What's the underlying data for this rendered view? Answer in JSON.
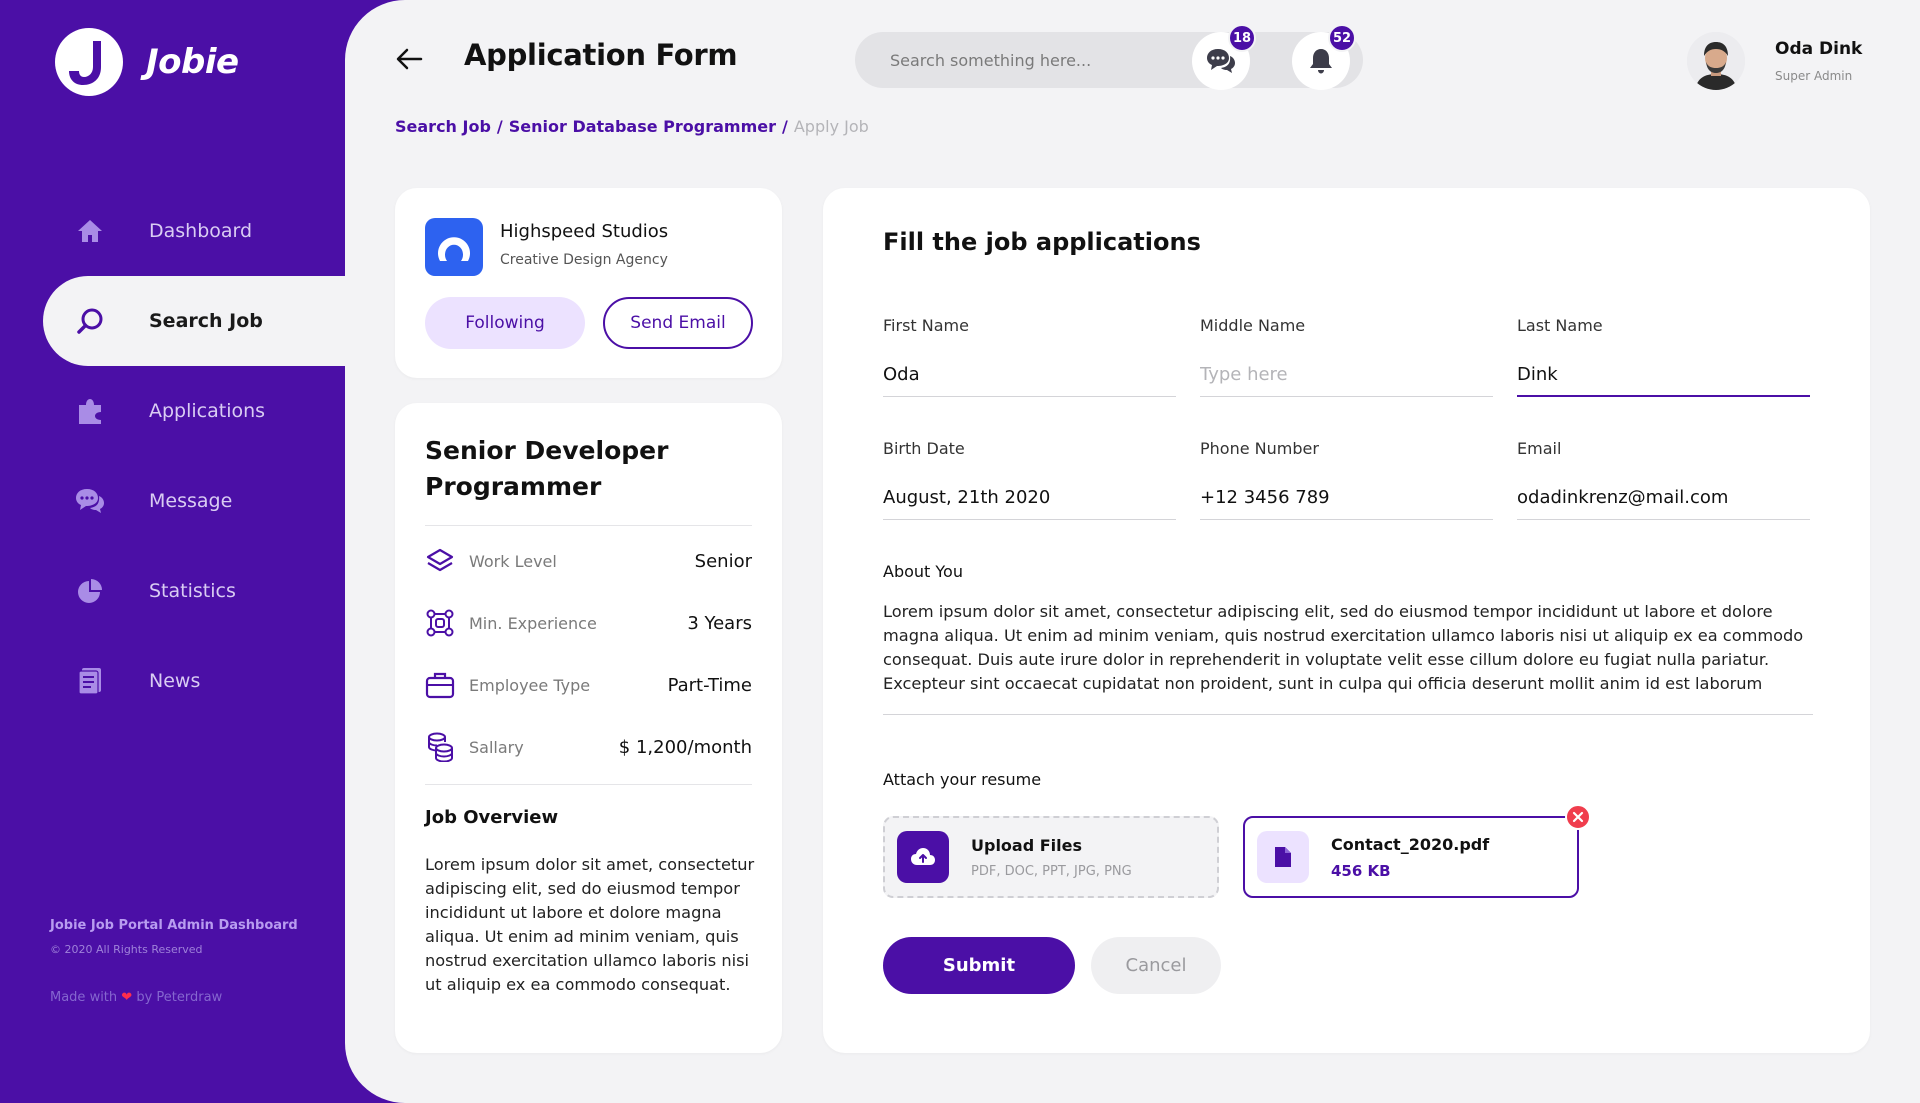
{
  "brand": {
    "name": "Jobie",
    "accent": "#4b0fa6"
  },
  "sidebar": {
    "items": [
      {
        "label": "Dashboard",
        "icon": "home-icon"
      },
      {
        "label": "Search Job",
        "icon": "search-icon",
        "active": true
      },
      {
        "label": "Applications",
        "icon": "puzzle-icon"
      },
      {
        "label": "Message",
        "icon": "chat-icon"
      },
      {
        "label": "Statistics",
        "icon": "pie-chart-icon"
      },
      {
        "label": "News",
        "icon": "news-icon"
      }
    ],
    "footer": {
      "title": "Jobie Job Portal Admin Dashboard",
      "copyright": "© 2020 All Rights Reserved",
      "made_prefix": "Made with",
      "made_suffix": "by Peterdraw"
    }
  },
  "header": {
    "title": "Application Form",
    "search_placeholder": "Search something here...",
    "messages_count": "18",
    "notifications_count": "52",
    "user": {
      "name": "Oda Dink",
      "role": "Super Admin"
    }
  },
  "breadcrumb": {
    "items": [
      "Search Job",
      "Senior Database Programmer"
    ],
    "separator": "/",
    "current": "Apply Job"
  },
  "company": {
    "name": "Highspeed Studios",
    "type": "Creative Design Agency",
    "following_label": "Following",
    "email_label": "Send Email"
  },
  "job": {
    "title": "Senior Developer Programmer",
    "details": [
      {
        "label": "Work Level",
        "value": "Senior",
        "icon": "layers-icon"
      },
      {
        "label": "Min. Experience",
        "value": "3 Years",
        "icon": "network-icon"
      },
      {
        "label": "Employee Type",
        "value": "Part-Time",
        "icon": "briefcase-icon"
      },
      {
        "label": "Sallary",
        "value": "$ 1,200/month",
        "icon": "coins-icon"
      }
    ],
    "overview_title": "Job Overview",
    "overview_text": "Lorem ipsum dolor sit amet, consectetur adipiscing elit, sed do eiusmod tempor incididunt ut labore et dolore magna aliqua. Ut enim ad minim veniam, quis nostrud exercitation ullamco laboris nisi ut aliquip ex ea commodo consequat."
  },
  "form": {
    "title": "Fill the job applications",
    "fields": {
      "first_name": {
        "label": "First Name",
        "value": "Oda",
        "placeholder": "Type here"
      },
      "middle_name": {
        "label": "Middle Name",
        "value": "",
        "placeholder": "Type here"
      },
      "last_name": {
        "label": "Last Name",
        "value": "Dink",
        "placeholder": "Type here"
      },
      "birth_date": {
        "label": "Birth Date",
        "value": "August, 21th 2020",
        "placeholder": "Type here"
      },
      "phone": {
        "label": "Phone Number",
        "value": "+12 3456 789",
        "placeholder": "Type here"
      },
      "email": {
        "label": "Email",
        "value": "odadinkrenz@mail.com",
        "placeholder": "Type here"
      }
    },
    "about_label": "About You",
    "about_text": "Lorem ipsum dolor sit amet, consectetur adipiscing elit, sed do eiusmod tempor incididunt ut labore et dolore magna aliqua. Ut enim ad minim veniam, quis nostrud exercitation ullamco laboris nisi ut aliquip ex ea commodo consequat. Duis aute irure dolor in reprehenderit in voluptate velit esse cillum dolore eu fugiat nulla pariatur. Excepteur sint occaecat cupidatat non proident, sunt in culpa qui officia deserunt mollit anim id est laborum",
    "attach_label": "Attach your resume",
    "upload": {
      "title": "Upload Files",
      "formats": "PDF, DOC, PPT, JPG, PNG"
    },
    "file": {
      "name": "Contact_2020.pdf",
      "size": "456 KB"
    },
    "submit_label": "Submit",
    "cancel_label": "Cancel"
  }
}
